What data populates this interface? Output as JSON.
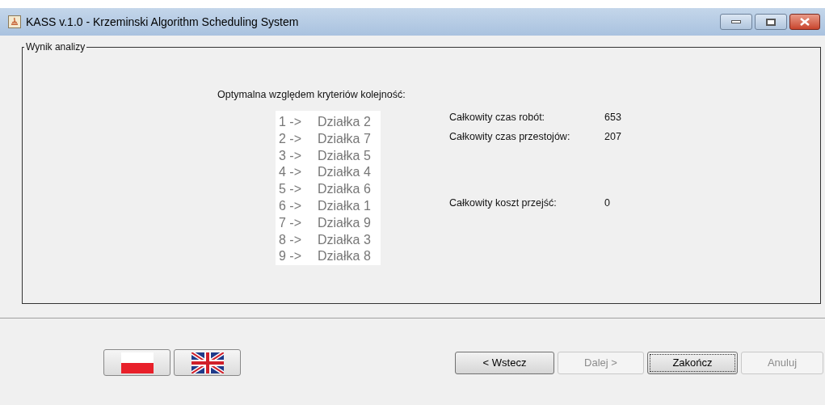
{
  "window": {
    "title": "KASS v.1.0 - Krzeminski Algorithm Scheduling System"
  },
  "group": {
    "title": "Wynik analizy"
  },
  "sequence": {
    "heading": "Optymalna względem kryteriów kolejność:",
    "items": [
      {
        "index": "1 ->",
        "name": "Działka 2"
      },
      {
        "index": "2 ->",
        "name": "Działka 7"
      },
      {
        "index": "3 ->",
        "name": "Działka 5"
      },
      {
        "index": "4 ->",
        "name": "Działka 4"
      },
      {
        "index": "5 ->",
        "name": "Działka 6"
      },
      {
        "index": "6 ->",
        "name": "Działka 1"
      },
      {
        "index": "7 ->",
        "name": "Działka 9"
      },
      {
        "index": "8 ->",
        "name": "Działka 3"
      },
      {
        "index": "9 ->",
        "name": "Działka 8"
      }
    ]
  },
  "stats": [
    {
      "label": "Całkowity czas robót:",
      "value": "653"
    },
    {
      "label": "Całkowity czas przestojów:",
      "value": "207"
    },
    {
      "label": "Całkowity koszt przejść:",
      "value": "0"
    }
  ],
  "language_buttons": [
    {
      "kind": "pl"
    },
    {
      "kind": "uk"
    }
  ],
  "nav_buttons": [
    {
      "label": "< Wstecz",
      "disabled": false,
      "focused": false
    },
    {
      "label": "Dalej >",
      "disabled": true,
      "focused": false
    },
    {
      "label": "Zakończ",
      "disabled": false,
      "focused": true
    },
    {
      "label": "Anuluj",
      "disabled": true,
      "focused": false
    }
  ]
}
